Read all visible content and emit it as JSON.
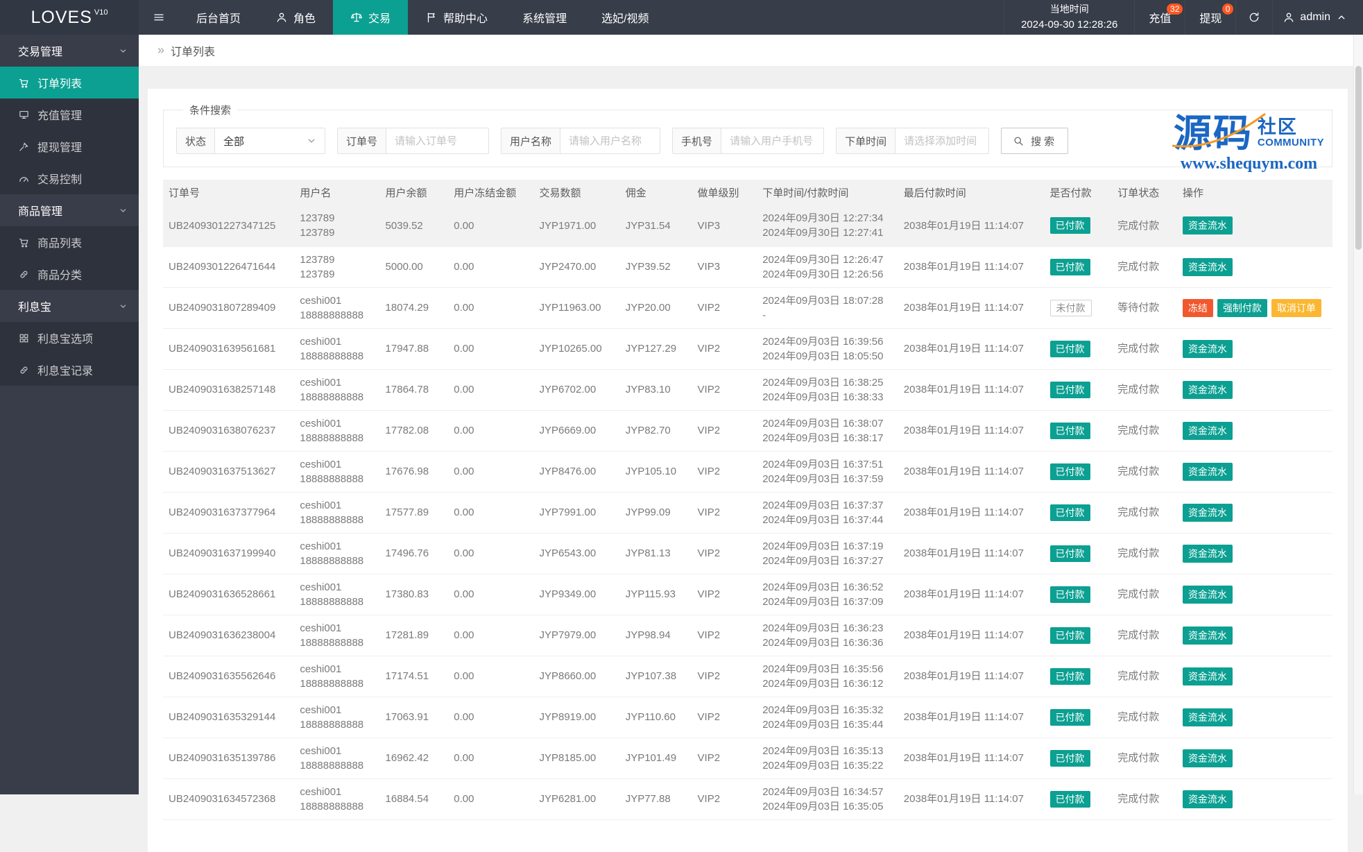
{
  "accent": "#0CA092",
  "topbar": {
    "logo": "LOVES",
    "logo_sup": "V10",
    "nav": [
      {
        "label": "后台首页",
        "icon": null,
        "active": false
      },
      {
        "label": "角色",
        "icon": "user",
        "active": false
      },
      {
        "label": "交易",
        "icon": "scales",
        "active": true
      },
      {
        "label": "帮助中心",
        "icon": "flag",
        "active": false
      },
      {
        "label": "系统管理",
        "icon": null,
        "active": false
      },
      {
        "label": "选妃/视频",
        "icon": null,
        "active": false
      }
    ],
    "time_label": "当地时间",
    "time_value": "2024-09-30 12:28:26",
    "quick": [
      {
        "id": "recharge",
        "label": "充值",
        "badge": "32"
      },
      {
        "id": "withdraw",
        "label": "提现",
        "badge": "0"
      }
    ],
    "user": "admin"
  },
  "sidebar": {
    "groups": [
      {
        "label": "交易管理",
        "items": [
          {
            "label": "订单列表",
            "icon": "cart",
            "active": true
          },
          {
            "label": "充值管理",
            "icon": "recharge",
            "active": false
          },
          {
            "label": "提现管理",
            "icon": "gavel",
            "active": false
          },
          {
            "label": "交易控制",
            "icon": "gauge",
            "active": false
          }
        ]
      },
      {
        "label": "商品管理",
        "items": [
          {
            "label": "商品列表",
            "icon": "cart",
            "active": false
          },
          {
            "label": "商品分类",
            "icon": "link",
            "active": false
          }
        ]
      },
      {
        "label": "利息宝",
        "items": [
          {
            "label": "利息宝选项",
            "icon": "grid",
            "active": false
          },
          {
            "label": "利息宝记录",
            "icon": "link",
            "active": false
          }
        ]
      }
    ]
  },
  "breadcrumb": {
    "arrow": "»",
    "label": "订单列表"
  },
  "filters": {
    "legend": "条件搜索",
    "status_label": "状态",
    "status_value": "全部",
    "order_label": "订单号",
    "order_placeholder": "请输入订单号",
    "user_label": "用户名称",
    "user_placeholder": "请输入用户名称",
    "phone_label": "手机号",
    "phone_placeholder": "请输入用户手机号",
    "time_label": "下单时间",
    "time_placeholder": "请选择添加时间",
    "search_label": "搜索"
  },
  "watermark": {
    "big": "源码",
    "side_top": "社区",
    "side_bottom": "COMMUNITY",
    "url": "www.shequym.com",
    "blue": "#1B67C3",
    "orange": "#F59A23"
  },
  "table": {
    "columns": [
      "订单号",
      "用户名",
      "用户余额",
      "用户冻结金额",
      "交易数额",
      "佣金",
      "做单级别",
      "下单时间/付款时间",
      "最后付款时间",
      "是否付款",
      "订单状态",
      "操作"
    ],
    "rows": [
      {
        "order": "UB2409301227347125",
        "user": [
          "123789",
          "123789"
        ],
        "balance": "5039.52",
        "frozen": "0.00",
        "amount": "JYP1971.00",
        "commission": "JYP31.54",
        "level": "VIP3",
        "times": [
          "2024年09月30日 12:27:34",
          "2024年09月30日 12:27:41"
        ],
        "last_pay": "2038年01月19日 11:14:07",
        "paid": "已付款",
        "paid_type": "paid",
        "status": "完成付款",
        "highlight": true,
        "actions": [
          {
            "name": "funds-flow",
            "label": "资金流水",
            "type": "teal"
          }
        ]
      },
      {
        "order": "UB2409301226471644",
        "user": [
          "123789",
          "123789"
        ],
        "balance": "5000.00",
        "frozen": "0.00",
        "amount": "JYP2470.00",
        "commission": "JYP39.52",
        "level": "VIP3",
        "times": [
          "2024年09月30日 12:26:47",
          "2024年09月30日 12:26:56"
        ],
        "last_pay": "2038年01月19日 11:14:07",
        "paid": "已付款",
        "paid_type": "paid",
        "status": "完成付款",
        "highlight": false,
        "actions": [
          {
            "name": "funds-flow",
            "label": "资金流水",
            "type": "teal"
          }
        ]
      },
      {
        "order": "UB2409031807289409",
        "user": [
          "ceshi001",
          "18888888888"
        ],
        "balance": "18074.29",
        "frozen": "0.00",
        "amount": "JYP11963.00",
        "commission": "JYP20.00",
        "level": "VIP2",
        "times": [
          "2024年09月03日 18:07:28",
          "-"
        ],
        "last_pay": "2038年01月19日 11:14:07",
        "paid": "未付款",
        "paid_type": "unpaid",
        "status": "等待付款",
        "highlight": false,
        "actions": [
          {
            "name": "freeze",
            "label": "冻结",
            "type": "red"
          },
          {
            "name": "force-pay",
            "label": "强制付款",
            "type": "teal"
          },
          {
            "name": "cancel-order",
            "label": "取消订单",
            "type": "yellow"
          }
        ]
      },
      {
        "order": "UB2409031639561681",
        "user": [
          "ceshi001",
          "18888888888"
        ],
        "balance": "17947.88",
        "frozen": "0.00",
        "amount": "JYP10265.00",
        "commission": "JYP127.29",
        "level": "VIP2",
        "times": [
          "2024年09月03日 16:39:56",
          "2024年09月03日 18:05:50"
        ],
        "last_pay": "2038年01月19日 11:14:07",
        "paid": "已付款",
        "paid_type": "paid",
        "status": "完成付款",
        "highlight": false,
        "actions": [
          {
            "name": "funds-flow",
            "label": "资金流水",
            "type": "teal"
          }
        ]
      },
      {
        "order": "UB2409031638257148",
        "user": [
          "ceshi001",
          "18888888888"
        ],
        "balance": "17864.78",
        "frozen": "0.00",
        "amount": "JYP6702.00",
        "commission": "JYP83.10",
        "level": "VIP2",
        "times": [
          "2024年09月03日 16:38:25",
          "2024年09月03日 16:38:33"
        ],
        "last_pay": "2038年01月19日 11:14:07",
        "paid": "已付款",
        "paid_type": "paid",
        "status": "完成付款",
        "highlight": false,
        "actions": [
          {
            "name": "funds-flow",
            "label": "资金流水",
            "type": "teal"
          }
        ]
      },
      {
        "order": "UB2409031638076237",
        "user": [
          "ceshi001",
          "18888888888"
        ],
        "balance": "17782.08",
        "frozen": "0.00",
        "amount": "JYP6669.00",
        "commission": "JYP82.70",
        "level": "VIP2",
        "times": [
          "2024年09月03日 16:38:07",
          "2024年09月03日 16:38:17"
        ],
        "last_pay": "2038年01月19日 11:14:07",
        "paid": "已付款",
        "paid_type": "paid",
        "status": "完成付款",
        "highlight": false,
        "actions": [
          {
            "name": "funds-flow",
            "label": "资金流水",
            "type": "teal"
          }
        ]
      },
      {
        "order": "UB2409031637513627",
        "user": [
          "ceshi001",
          "18888888888"
        ],
        "balance": "17676.98",
        "frozen": "0.00",
        "amount": "JYP8476.00",
        "commission": "JYP105.10",
        "level": "VIP2",
        "times": [
          "2024年09月03日 16:37:51",
          "2024年09月03日 16:37:59"
        ],
        "last_pay": "2038年01月19日 11:14:07",
        "paid": "已付款",
        "paid_type": "paid",
        "status": "完成付款",
        "highlight": false,
        "actions": [
          {
            "name": "funds-flow",
            "label": "资金流水",
            "type": "teal"
          }
        ]
      },
      {
        "order": "UB2409031637377964",
        "user": [
          "ceshi001",
          "18888888888"
        ],
        "balance": "17577.89",
        "frozen": "0.00",
        "amount": "JYP7991.00",
        "commission": "JYP99.09",
        "level": "VIP2",
        "times": [
          "2024年09月03日 16:37:37",
          "2024年09月03日 16:37:44"
        ],
        "last_pay": "2038年01月19日 11:14:07",
        "paid": "已付款",
        "paid_type": "paid",
        "status": "完成付款",
        "highlight": false,
        "actions": [
          {
            "name": "funds-flow",
            "label": "资金流水",
            "type": "teal"
          }
        ]
      },
      {
        "order": "UB2409031637199940",
        "user": [
          "ceshi001",
          "18888888888"
        ],
        "balance": "17496.76",
        "frozen": "0.00",
        "amount": "JYP6543.00",
        "commission": "JYP81.13",
        "level": "VIP2",
        "times": [
          "2024年09月03日 16:37:19",
          "2024年09月03日 16:37:27"
        ],
        "last_pay": "2038年01月19日 11:14:07",
        "paid": "已付款",
        "paid_type": "paid",
        "status": "完成付款",
        "highlight": false,
        "actions": [
          {
            "name": "funds-flow",
            "label": "资金流水",
            "type": "teal"
          }
        ]
      },
      {
        "order": "UB2409031636528661",
        "user": [
          "ceshi001",
          "18888888888"
        ],
        "balance": "17380.83",
        "frozen": "0.00",
        "amount": "JYP9349.00",
        "commission": "JYP115.93",
        "level": "VIP2",
        "times": [
          "2024年09月03日 16:36:52",
          "2024年09月03日 16:37:09"
        ],
        "last_pay": "2038年01月19日 11:14:07",
        "paid": "已付款",
        "paid_type": "paid",
        "status": "完成付款",
        "highlight": false,
        "actions": [
          {
            "name": "funds-flow",
            "label": "资金流水",
            "type": "teal"
          }
        ]
      },
      {
        "order": "UB2409031636238004",
        "user": [
          "ceshi001",
          "18888888888"
        ],
        "balance": "17281.89",
        "frozen": "0.00",
        "amount": "JYP7979.00",
        "commission": "JYP98.94",
        "level": "VIP2",
        "times": [
          "2024年09月03日 16:36:23",
          "2024年09月03日 16:36:36"
        ],
        "last_pay": "2038年01月19日 11:14:07",
        "paid": "已付款",
        "paid_type": "paid",
        "status": "完成付款",
        "highlight": false,
        "actions": [
          {
            "name": "funds-flow",
            "label": "资金流水",
            "type": "teal"
          }
        ]
      },
      {
        "order": "UB2409031635562646",
        "user": [
          "ceshi001",
          "18888888888"
        ],
        "balance": "17174.51",
        "frozen": "0.00",
        "amount": "JYP8660.00",
        "commission": "JYP107.38",
        "level": "VIP2",
        "times": [
          "2024年09月03日 16:35:56",
          "2024年09月03日 16:36:12"
        ],
        "last_pay": "2038年01月19日 11:14:07",
        "paid": "已付款",
        "paid_type": "paid",
        "status": "完成付款",
        "highlight": false,
        "actions": [
          {
            "name": "funds-flow",
            "label": "资金流水",
            "type": "teal"
          }
        ]
      },
      {
        "order": "UB2409031635329144",
        "user": [
          "ceshi001",
          "18888888888"
        ],
        "balance": "17063.91",
        "frozen": "0.00",
        "amount": "JYP8919.00",
        "commission": "JYP110.60",
        "level": "VIP2",
        "times": [
          "2024年09月03日 16:35:32",
          "2024年09月03日 16:35:44"
        ],
        "last_pay": "2038年01月19日 11:14:07",
        "paid": "已付款",
        "paid_type": "paid",
        "status": "完成付款",
        "highlight": false,
        "actions": [
          {
            "name": "funds-flow",
            "label": "资金流水",
            "type": "teal"
          }
        ]
      },
      {
        "order": "UB2409031635139786",
        "user": [
          "ceshi001",
          "18888888888"
        ],
        "balance": "16962.42",
        "frozen": "0.00",
        "amount": "JYP8185.00",
        "commission": "JYP101.49",
        "level": "VIP2",
        "times": [
          "2024年09月03日 16:35:13",
          "2024年09月03日 16:35:22"
        ],
        "last_pay": "2038年01月19日 11:14:07",
        "paid": "已付款",
        "paid_type": "paid",
        "status": "完成付款",
        "highlight": false,
        "actions": [
          {
            "name": "funds-flow",
            "label": "资金流水",
            "type": "teal"
          }
        ]
      },
      {
        "order": "UB2409031634572368",
        "user": [
          "ceshi001",
          "18888888888"
        ],
        "balance": "16884.54",
        "frozen": "0.00",
        "amount": "JYP6281.00",
        "commission": "JYP77.88",
        "level": "VIP2",
        "times": [
          "2024年09月03日 16:34:57",
          "2024年09月03日 16:35:05"
        ],
        "last_pay": "2038年01月19日 11:14:07",
        "paid": "已付款",
        "paid_type": "paid",
        "status": "完成付款",
        "highlight": false,
        "actions": [
          {
            "name": "funds-flow",
            "label": "资金流水",
            "type": "teal"
          }
        ]
      }
    ]
  }
}
